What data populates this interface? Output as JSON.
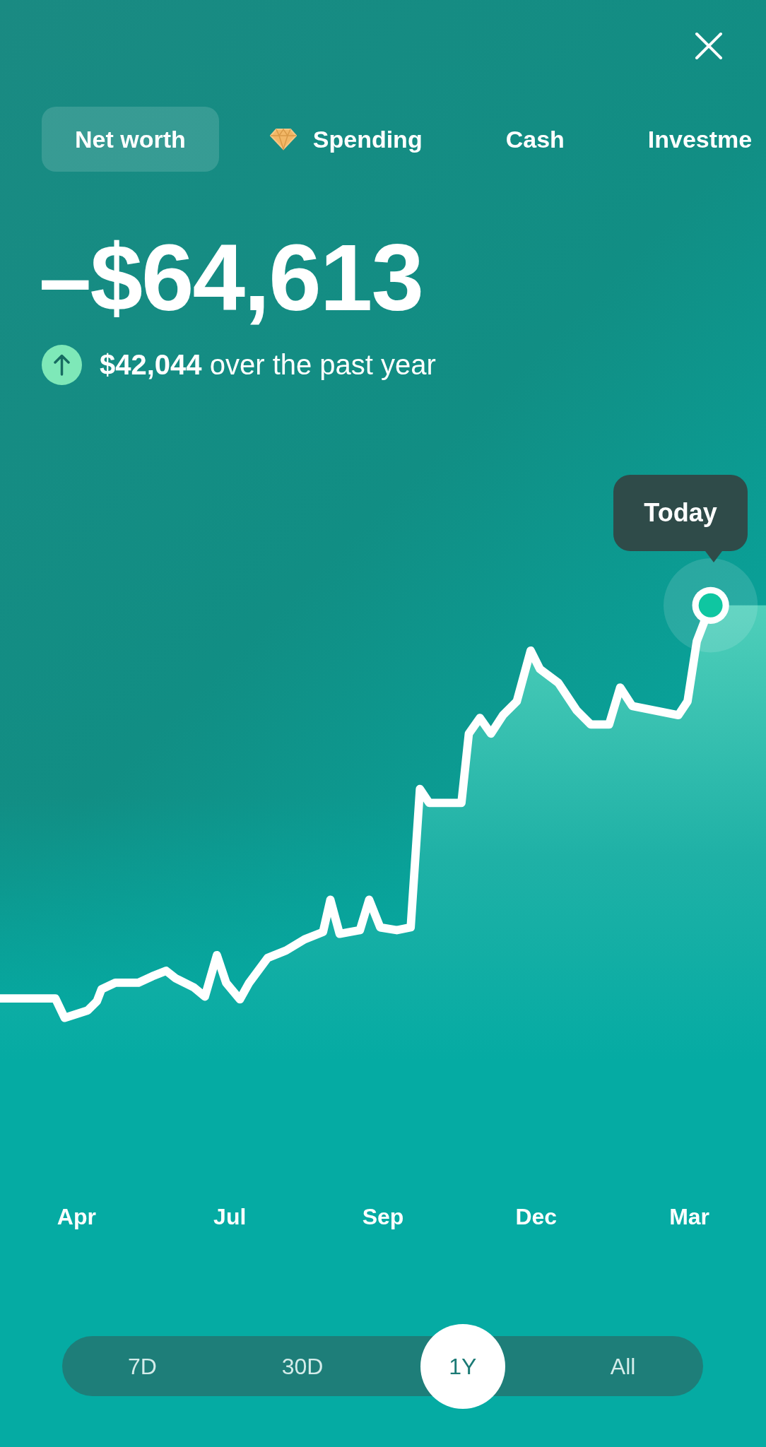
{
  "tabs": [
    {
      "label": "Net worth",
      "selected": true,
      "kind": "plain"
    },
    {
      "label": "Spending",
      "selected": false,
      "kind": "premium"
    },
    {
      "label": "Cash",
      "selected": false,
      "kind": "plain"
    },
    {
      "label": "Investme",
      "selected": false,
      "kind": "plain"
    }
  ],
  "amount": "–$64,613",
  "change": {
    "increase": true,
    "text": "**$42,044** over the past year"
  },
  "tooltip": "Today",
  "x_labels": [
    "Apr",
    "Jul",
    "Sep",
    "Dec",
    "Mar"
  ],
  "ranges": [
    {
      "label": "7D",
      "selected": false
    },
    {
      "label": "30D",
      "selected": false
    },
    {
      "label": "1Y",
      "selected": true
    },
    {
      "label": "All",
      "selected": false
    }
  ]
}
